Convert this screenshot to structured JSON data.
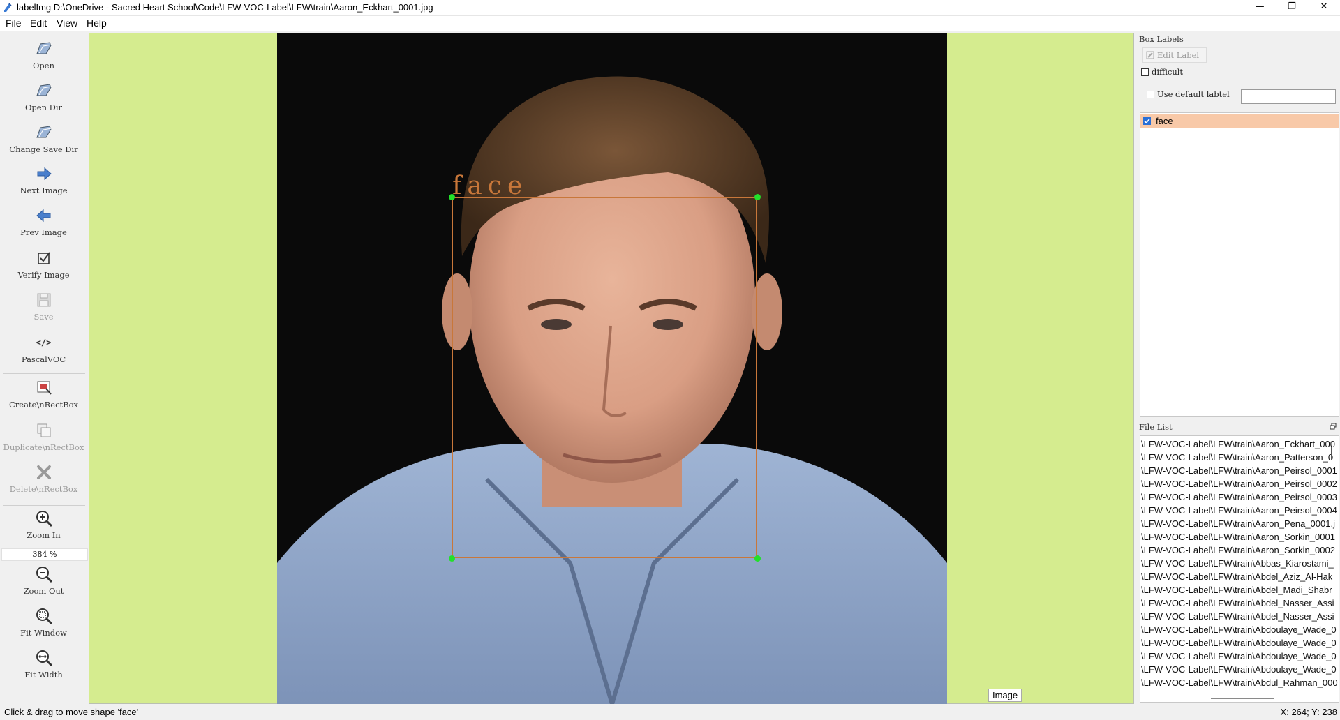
{
  "window": {
    "title": "labelImg D:\\OneDrive - Sacred Heart School\\Code\\LFW-VOC-Label\\LFW\\train\\Aaron_Eckhart_0001.jpg",
    "minimize_glyph": "—",
    "maximize_glyph": "❐",
    "close_glyph": "✕"
  },
  "menu": {
    "file": "File",
    "edit": "Edit",
    "view": "View",
    "help": "Help"
  },
  "toolbar": {
    "open": "Open",
    "open_dir": "Open Dir",
    "change_save_dir": "Change Save Dir",
    "next_image": "Next Image",
    "prev_image": "Prev Image",
    "verify_image": "Verify Image",
    "save": "Save",
    "format": "PascalVOC",
    "format_icon_text": "</>",
    "create_rectbox": "Create\\nRectBox",
    "duplicate_rectbox": "Duplicate\\nRectBox",
    "delete_rectbox": "Delete\\nRectBox",
    "zoom_in": "Zoom In",
    "zoom_value": "384 %",
    "zoom_out": "Zoom Out",
    "fit_window": "Fit Window",
    "fit_width": "Fit Width"
  },
  "canvas": {
    "shape_label": "face",
    "image_tag": "Image",
    "background_color": "#d5ec8f",
    "box_color": "#c8773a",
    "vertex_color": "#22e02a"
  },
  "box_labels": {
    "title": "Box Labels",
    "edit_label": "Edit Label",
    "difficult": "difficult",
    "difficult_checked": false,
    "use_default_label": "Use default labtel",
    "use_default_checked": false,
    "default_label_value": "",
    "items": [
      {
        "label": "face",
        "checked": true,
        "highlight": "#f8c9a8"
      }
    ]
  },
  "file_list": {
    "title": "File List",
    "files": [
      "\\LFW-VOC-Label\\LFW\\train\\Aaron_Eckhart_000",
      "\\LFW-VOC-Label\\LFW\\train\\Aaron_Patterson_0",
      "\\LFW-VOC-Label\\LFW\\train\\Aaron_Peirsol_0001",
      "\\LFW-VOC-Label\\LFW\\train\\Aaron_Peirsol_0002",
      "\\LFW-VOC-Label\\LFW\\train\\Aaron_Peirsol_0003",
      "\\LFW-VOC-Label\\LFW\\train\\Aaron_Peirsol_0004",
      "\\LFW-VOC-Label\\LFW\\train\\Aaron_Pena_0001.j",
      "\\LFW-VOC-Label\\LFW\\train\\Aaron_Sorkin_0001",
      "\\LFW-VOC-Label\\LFW\\train\\Aaron_Sorkin_0002",
      "\\LFW-VOC-Label\\LFW\\train\\Abbas_Kiarostami_",
      "\\LFW-VOC-Label\\LFW\\train\\Abdel_Aziz_Al-Hak",
      "\\LFW-VOC-Label\\LFW\\train\\Abdel_Madi_Shabr",
      "\\LFW-VOC-Label\\LFW\\train\\Abdel_Nasser_Assi",
      "\\LFW-VOC-Label\\LFW\\train\\Abdel_Nasser_Assi",
      "\\LFW-VOC-Label\\LFW\\train\\Abdoulaye_Wade_0",
      "\\LFW-VOC-Label\\LFW\\train\\Abdoulaye_Wade_0",
      "\\LFW-VOC-Label\\LFW\\train\\Abdoulaye_Wade_0",
      "\\LFW-VOC-Label\\LFW\\train\\Abdoulaye_Wade_0",
      "\\LFW-VOC-Label\\LFW\\train\\Abdul_Rahman_000"
    ]
  },
  "status": {
    "message": "Click & drag to move shape 'face'",
    "coords": "X: 264; Y: 238"
  }
}
